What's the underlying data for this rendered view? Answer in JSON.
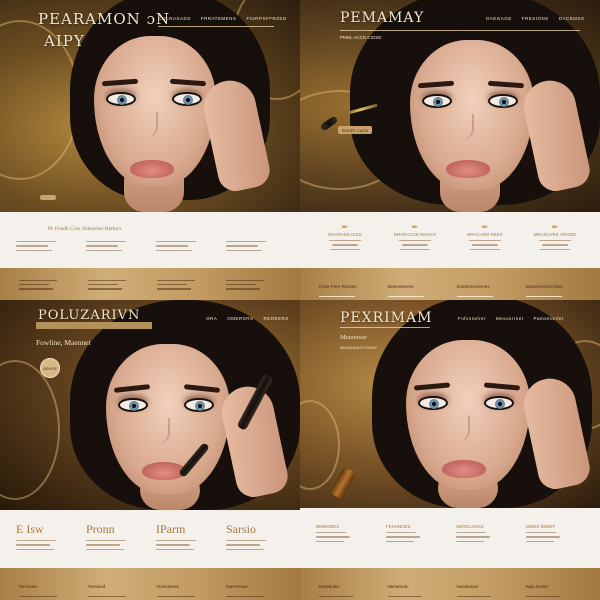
{
  "colors": {
    "gold_accent": "#a57a3b",
    "footer_gold": "#c29c63",
    "page_white": "#f4f1ed",
    "cream_text": "#f3e6cf"
  },
  "panel1": {
    "title": "PEARAMON",
    "title_suffix": "ɔN",
    "subtitle": "AIPY",
    "nav": [
      "CUCRASADS",
      "FRRATEMENS",
      "FIURPSFFRZED"
    ],
    "hero_button": "",
    "info_title": "Pe Fnadh Cros Sblenshss Rnthn's",
    "columns": [
      "",
      "",
      "",
      ""
    ],
    "footer": [
      "",
      "",
      "",
      ""
    ]
  },
  "panel2": {
    "title": "PEMAMAY",
    "nav": [
      "DAEGAGE",
      "FRESIONS",
      "DACEMSS"
    ],
    "tagline": "PMNL ACCN CIOSE",
    "hero_button": "EMOFE CACH",
    "columns": [
      "ENARANS ICSS",
      "ERARACCE ENACH",
      "BRACARD KEES",
      "MEASUVES SROOE"
    ],
    "footer": [
      "Creer Fere Rasses",
      "Manerteinres",
      "Ssiclemncermes",
      "Saoeremchemises"
    ]
  },
  "panel3": {
    "title": "POLUZARIVN",
    "nav": [
      "ORA",
      "OMERSRS",
      "REREERS"
    ],
    "tagline": "Fowline, Maennet",
    "circle_button": "AEHOE",
    "columns": [
      "E Isw",
      "Pronn",
      "IParm",
      "Sarsio"
    ],
    "footer": [
      "Tomsuies",
      "Tossuied",
      "Vonsoleres",
      "Samrrenee"
    ]
  },
  "panel4": {
    "title": "PEXRIMAM",
    "nav": [
      "Fohinselrer",
      "Mesosrrnet",
      "Pamsmonfer"
    ],
    "tagline": "Mauoosoc",
    "tagline2": "MMIAMNAS FOARE",
    "columns": [
      "BMMODES",
      "FESHNDES",
      "SERSCANCE",
      "MMES IMMET"
    ],
    "footer": [
      "Drewtirate",
      "Nemeredo",
      "Nueatssoe",
      "Wpa Doser"
    ]
  }
}
